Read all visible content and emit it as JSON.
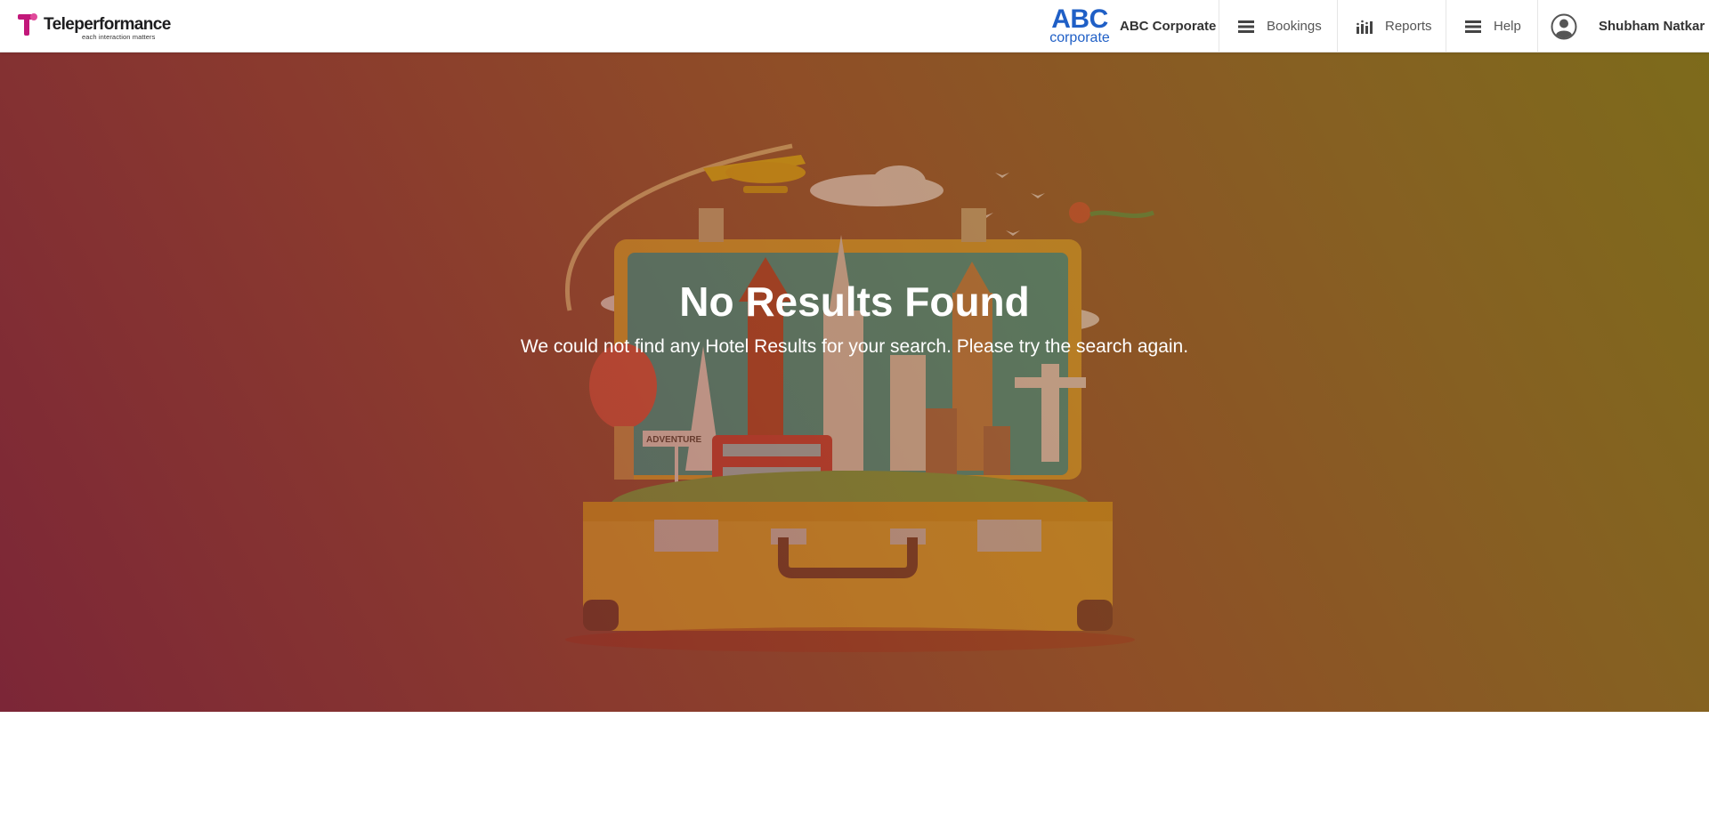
{
  "header": {
    "brand": {
      "name": "Teleperformance",
      "tagline": "each interaction matters"
    },
    "company": {
      "logo_abc": "ABC",
      "logo_sub": "corporate",
      "name": "ABC Corporate"
    },
    "nav": [
      {
        "label": "Bookings",
        "icon": "menu-icon"
      },
      {
        "label": "Reports",
        "icon": "bar-chart-icon"
      },
      {
        "label": "Help",
        "icon": "menu-icon"
      }
    ],
    "user": {
      "name": "Shubham Natkar",
      "icon": "user-avatar-icon"
    }
  },
  "hero": {
    "title": "No Results Found",
    "message": "We could not find any Hotel Results for your search. Please try the search again.",
    "sign_text": "ADVENTURE"
  },
  "colors": {
    "brand_magenta": "#c2187a",
    "corp_blue": "#1f5fc6",
    "hero_left": "#7c2637",
    "hero_right": "#7d6b1b"
  }
}
